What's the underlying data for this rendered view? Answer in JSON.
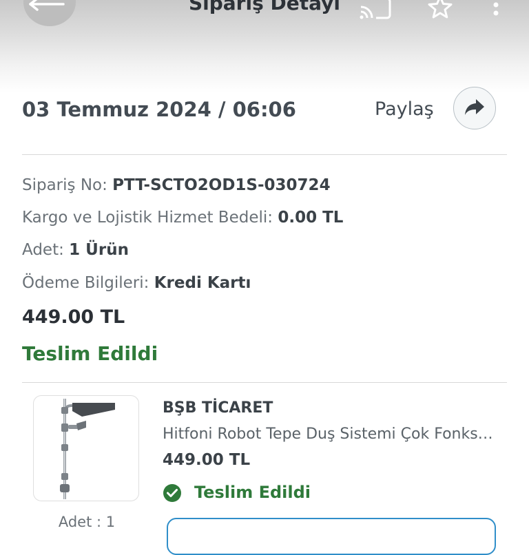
{
  "header": {
    "title": "Sipariş Detayı",
    "icons": [
      "back-arrow-icon",
      "cast-icon",
      "star-icon",
      "more-vertical-icon"
    ]
  },
  "order": {
    "date": "03 Temmuz 2024 / 06:06",
    "share_label": "Paylaş",
    "order_no_label": "Sipariş No:",
    "order_no": "PTT-SCTO2OD1S-030724",
    "shipping_label": "Kargo ve Lojistik Hizmet Bedeli:",
    "shipping_fee": "0.00 TL",
    "quantity_label": "Adet:",
    "quantity": "1 Ürün",
    "payment_label": "Ödeme Bilgileri:",
    "payment_method": "Kredi Kartı",
    "total": "449.00 TL",
    "status": "Teslim Edildi"
  },
  "item": {
    "seller": "BŞB TİCARET",
    "name": "Hitfoni Robot Tepe Duş Sistemi Çok Fonksiyonlu",
    "price": "449.00 TL",
    "status": "Teslim Edildi",
    "quantity_text": "Adet : 1"
  },
  "colors": {
    "status_green": "#2f7a3a",
    "text_dark": "#434b53",
    "button_border": "#2f8ec9"
  }
}
